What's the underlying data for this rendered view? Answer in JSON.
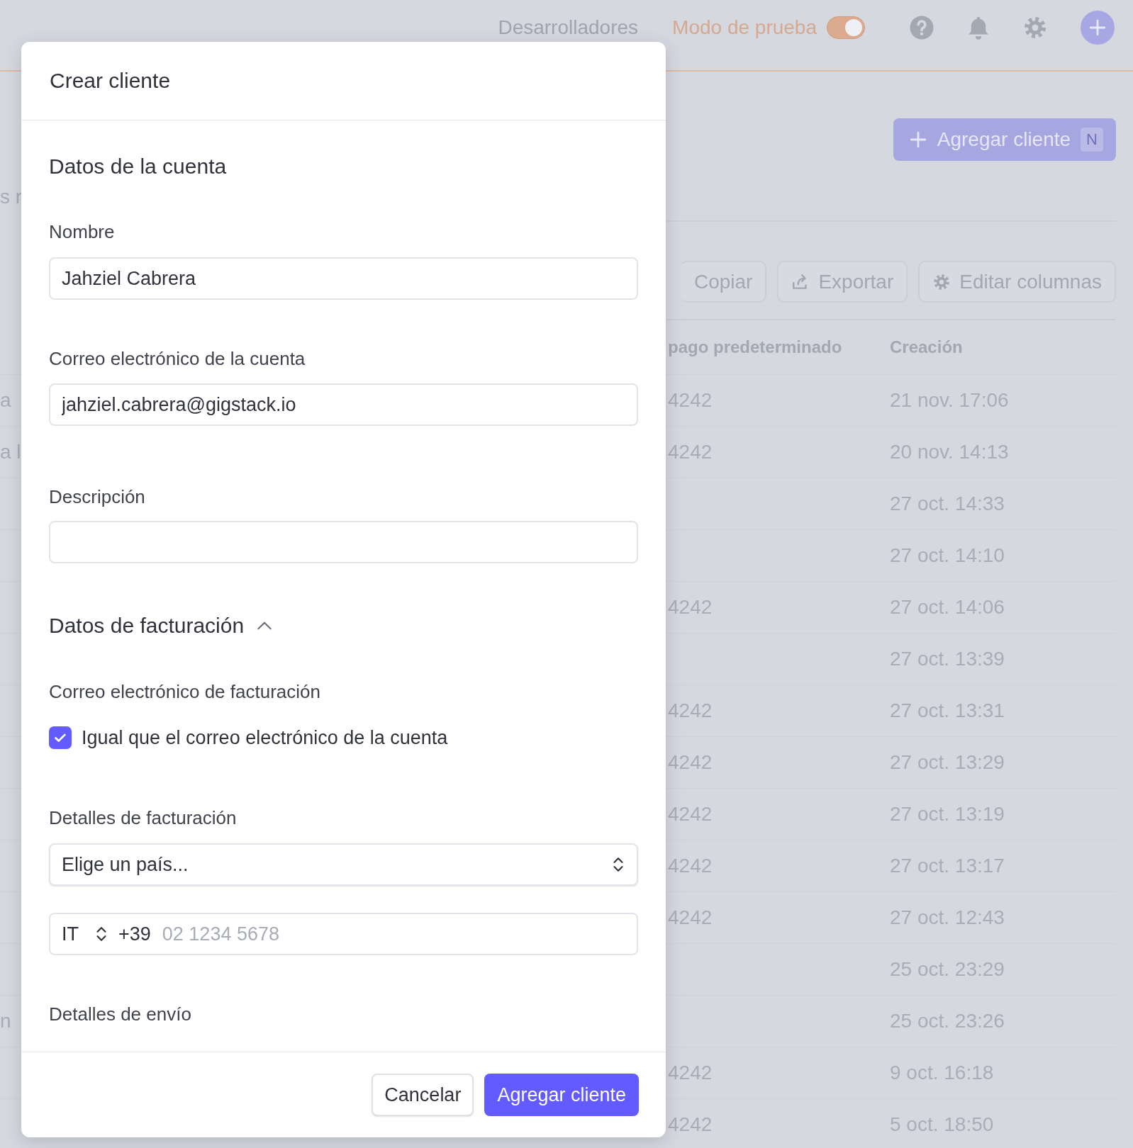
{
  "topbar": {
    "developers_link": "Desarrolladores",
    "test_mode": {
      "label": "Modo de prueba",
      "on": true
    }
  },
  "add_customer_button": {
    "label": "Agregar cliente",
    "shortcut": "N"
  },
  "subtitle_fragment": "s r",
  "toolbar": [
    {
      "label": "Copiar"
    },
    {
      "label": "Exportar",
      "kind": "export"
    },
    {
      "label": "Editar columnas",
      "kind": "columns"
    }
  ],
  "table": {
    "columns": [
      {
        "label": "pago predeterminado"
      },
      {
        "label": "Creación"
      }
    ],
    "rows": [
      {
        "column_0": "a",
        "payment": "4242",
        "created": "21 nov. 17:06"
      },
      {
        "column_0": "a l",
        "payment": "4242",
        "created": "20 nov. 14:13"
      },
      {
        "created": "27 oct. 14:33"
      },
      {
        "created": "27 oct. 14:10"
      },
      {
        "payment": "4242",
        "created": "27 oct. 14:06"
      },
      {
        "created": "27 oct. 13:39"
      },
      {
        "payment": "4242",
        "created": "27 oct. 13:31"
      },
      {
        "payment": "4242",
        "created": "27 oct. 13:29"
      },
      {
        "payment": "4242",
        "created": "27 oct. 13:19"
      },
      {
        "payment": "4242",
        "created": "27 oct. 13:17"
      },
      {
        "payment": "4242",
        "created": "27 oct. 12:43"
      },
      {
        "created": "25 oct. 23:29"
      },
      {
        "column_0": "n",
        "created": "25 oct. 23:26"
      },
      {
        "payment": "4242",
        "created": "9 oct. 16:18"
      },
      {
        "payment": "4242",
        "created": "5 oct. 18:50"
      }
    ]
  },
  "dialog": {
    "title": "Crear cliente",
    "account_heading": "Datos de la cuenta",
    "name": {
      "label": "Nombre",
      "value": "Jahziel Cabrera"
    },
    "email": {
      "label": "Correo electrónico de la cuenta",
      "value": "jahziel.cabrera@gigstack.io"
    },
    "description": {
      "label": "Descripción"
    },
    "billing": {
      "heading": "Datos de facturación",
      "expanded": true,
      "email_label": "Correo electrónico de facturación",
      "same_email": {
        "label": "Igual que el correo electrónico de la cuenta",
        "checked": true
      },
      "details_label": "Detalles de facturación",
      "country": {
        "value": "Elige un país..."
      },
      "phone": {
        "country": "IT",
        "prefix": "+39",
        "placeholder": "02 1234 5678"
      }
    },
    "shipping_heading": "Detalles de envío",
    "buttons": {
      "cancel": "Cancelar",
      "submit": "Agregar cliente"
    }
  }
}
